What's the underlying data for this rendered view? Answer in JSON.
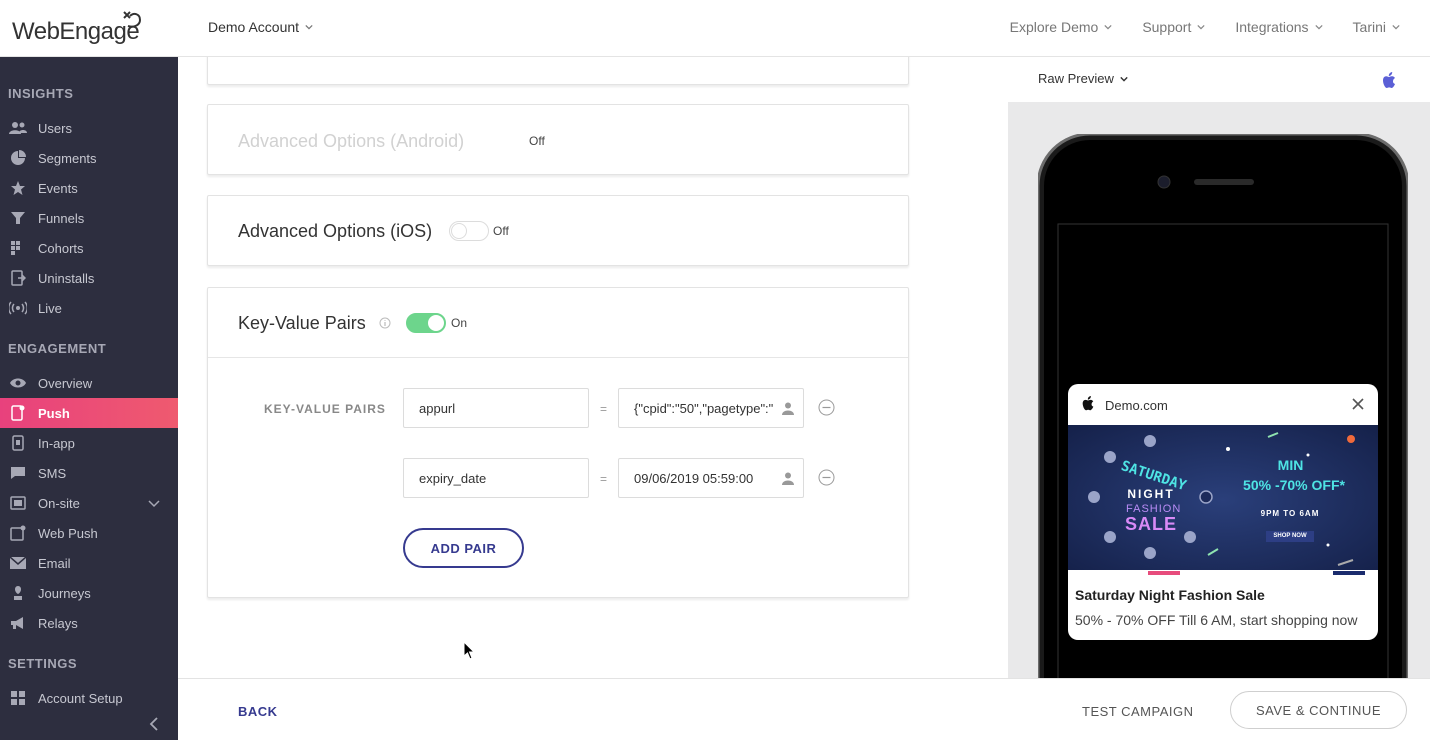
{
  "header": {
    "logo_text": "WebEngage",
    "account": "Demo Account",
    "nav": [
      "Explore Demo",
      "Support",
      "Integrations",
      "Tarini"
    ]
  },
  "sidebar": {
    "sections": {
      "insights": "INSIGHTS",
      "engagement": "ENGAGEMENT",
      "settings": "SETTINGS"
    },
    "insights_items": [
      {
        "label": "Users",
        "icon": "users-icon"
      },
      {
        "label": "Segments",
        "icon": "pie-icon"
      },
      {
        "label": "Events",
        "icon": "star-icon"
      },
      {
        "label": "Funnels",
        "icon": "funnel-icon"
      },
      {
        "label": "Cohorts",
        "icon": "cohorts-icon"
      },
      {
        "label": "Uninstalls",
        "icon": "uninstall-icon"
      },
      {
        "label": "Live",
        "icon": "live-icon"
      }
    ],
    "engagement_items": [
      {
        "label": "Overview",
        "icon": "eye-icon"
      },
      {
        "label": "Push",
        "icon": "push-icon",
        "active": true
      },
      {
        "label": "In-app",
        "icon": "inapp-icon"
      },
      {
        "label": "SMS",
        "icon": "sms-icon"
      },
      {
        "label": "On-site",
        "icon": "onsite-icon"
      },
      {
        "label": "Web Push",
        "icon": "webpush-icon"
      },
      {
        "label": "Email",
        "icon": "email-icon"
      },
      {
        "label": "Journeys",
        "icon": "journeys-icon"
      },
      {
        "label": "Relays",
        "icon": "relays-icon"
      }
    ],
    "settings_items": [
      {
        "label": "Account Setup",
        "icon": "grid-icon"
      }
    ]
  },
  "main": {
    "android_card": {
      "title": "Advanced Options (Android)",
      "toggle_label": "Off"
    },
    "ios_card": {
      "title": "Advanced Options (iOS)",
      "toggle_label": "Off",
      "enabled": false
    },
    "kv_card": {
      "title": "Key-Value Pairs",
      "toggle_label": "On",
      "enabled": true,
      "section_label": "KEY-VALUE PAIRS",
      "pairs": [
        {
          "key": "appurl",
          "value": "{\"cpid\":\"50\",\"pagetype\":\""
        },
        {
          "key": "expiry_date",
          "value": "09/06/2019 05:59:00"
        }
      ],
      "equals": "=",
      "add_pair": "ADD PAIR"
    }
  },
  "preview": {
    "mode": "Raw Preview",
    "notification": {
      "app": "Demo.com",
      "title": "Saturday Night Fashion Sale",
      "body": "50% - 70% OFF Till 6 AM, start shopping now"
    },
    "banner": {
      "line1": "SATURDAY",
      "line2": "NIGHT",
      "line3": "FASHION",
      "line4": "SALE",
      "min": "MIN",
      "discount": "50% -70% OFF*",
      "time": "9PM TO 6AM",
      "cta": "SHOP NOW"
    }
  },
  "footer": {
    "back": "BACK",
    "test": "TEST CAMPAIGN",
    "save": "SAVE & CONTINUE"
  },
  "colors": {
    "sidebar_bg": "#2d2e3f",
    "active_start": "#e8417d",
    "active_end": "#ef5a6f",
    "brand_blue": "#363a8f",
    "toggle_on": "#6dd58c"
  }
}
